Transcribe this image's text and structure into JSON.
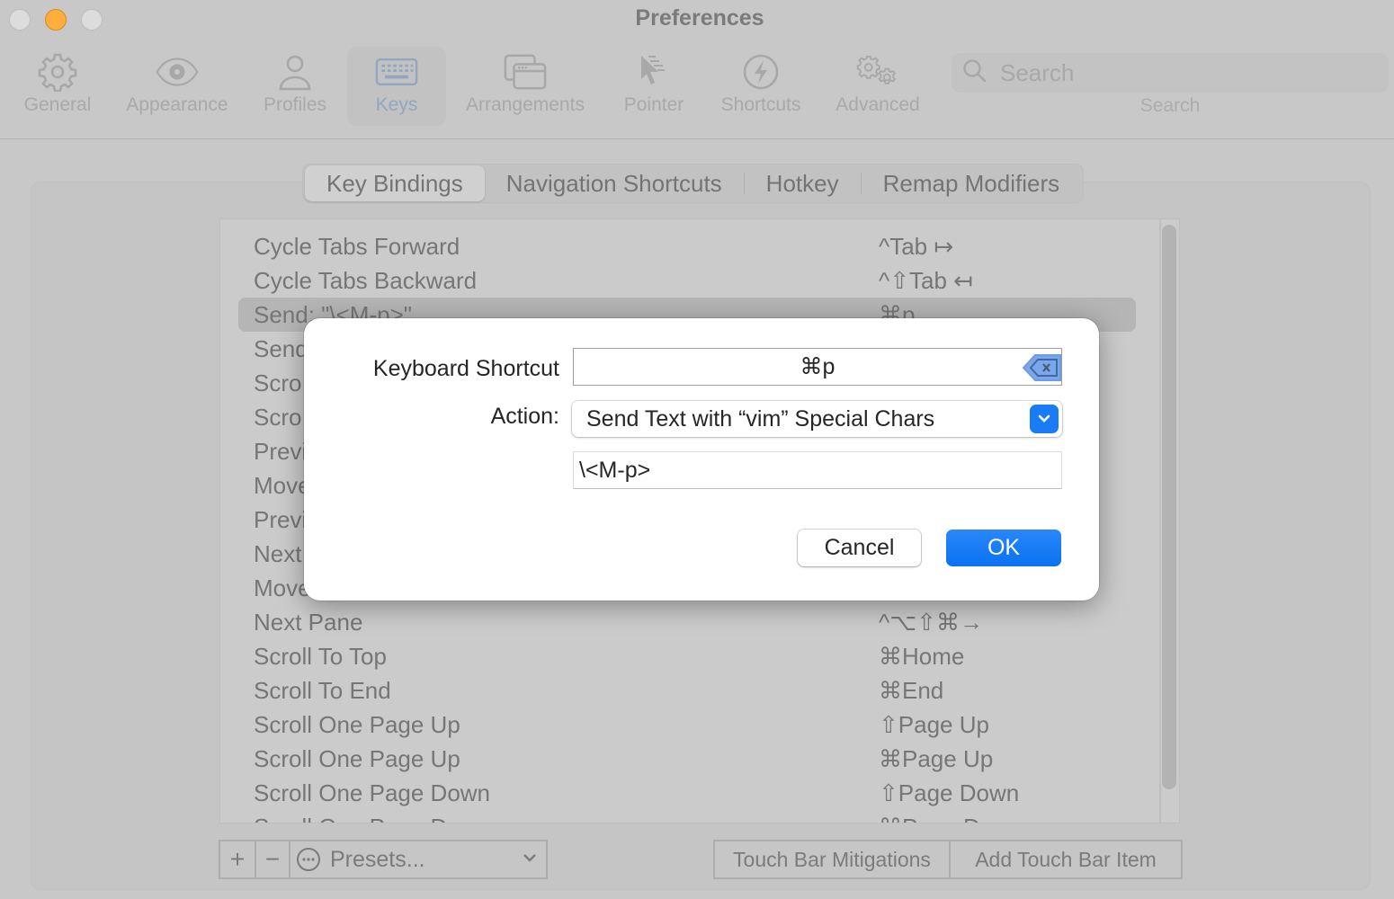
{
  "window": {
    "title": "Preferences",
    "traffic_lights": [
      "close",
      "minimize",
      "zoom"
    ]
  },
  "toolbar": {
    "items": [
      {
        "label": "General",
        "icon": "gear-icon"
      },
      {
        "label": "Appearance",
        "icon": "eye-icon"
      },
      {
        "label": "Profiles",
        "icon": "person-icon"
      },
      {
        "label": "Keys",
        "icon": "keyboard-icon",
        "active": true
      },
      {
        "label": "Arrangements",
        "icon": "windows-icon"
      },
      {
        "label": "Pointer",
        "icon": "pointer-icon"
      },
      {
        "label": "Shortcuts",
        "icon": "bolt-icon"
      },
      {
        "label": "Advanced",
        "icon": "gears-icon"
      }
    ],
    "search": {
      "placeholder": "Search",
      "value": "",
      "label": "Search"
    }
  },
  "tabs": {
    "items": [
      "Key Bindings",
      "Navigation Shortcuts",
      "Hotkey",
      "Remap Modifiers"
    ],
    "selected": "Key Bindings"
  },
  "bindings": {
    "rows": [
      {
        "action": "Cycle Tabs Forward",
        "shortcut": "^Tab ↦"
      },
      {
        "action": "Cycle Tabs Backward",
        "shortcut": "^⇧Tab ↤"
      },
      {
        "action": "Send: \"\\<M-p>\"",
        "shortcut": "⌘p",
        "selected": true
      },
      {
        "action": "Send",
        "shortcut": ""
      },
      {
        "action": "Scro",
        "shortcut": ""
      },
      {
        "action": "Scro",
        "shortcut": ""
      },
      {
        "action": "Previ",
        "shortcut": ""
      },
      {
        "action": "Move",
        "shortcut": ""
      },
      {
        "action": "Previ",
        "shortcut": ""
      },
      {
        "action": "Next",
        "shortcut": ""
      },
      {
        "action": "Move",
        "shortcut": ""
      },
      {
        "action": "Next Pane",
        "shortcut": "^⌥⇧⌘→"
      },
      {
        "action": "Scroll To Top",
        "shortcut": "⌘Home"
      },
      {
        "action": "Scroll To End",
        "shortcut": "⌘End"
      },
      {
        "action": "Scroll One Page Up",
        "shortcut": "⇧Page Up"
      },
      {
        "action": "Scroll One Page Up",
        "shortcut": "⌘Page Up"
      },
      {
        "action": "Scroll One Page Down",
        "shortcut": "⇧Page Down"
      },
      {
        "action": "Scroll One Page Down",
        "shortcut": "⌘Page Down"
      }
    ]
  },
  "bottom": {
    "add_label": "+",
    "remove_label": "−",
    "presets_label": "Presets...",
    "touch_bar_mitigations": "Touch Bar Mitigations",
    "add_touch_bar_item": "Add Touch Bar Item"
  },
  "dialog": {
    "shortcut_label": "Keyboard Shortcut",
    "shortcut_value": "⌘p",
    "action_label": "Action:",
    "action_value": "Send Text with “vim” Special Chars",
    "text_value": "\\<M-p>",
    "cancel_label": "Cancel",
    "ok_label": "OK"
  },
  "colors": {
    "accent": "#1a7cf5",
    "background": "#c8c8c8",
    "dialog_bg": "#ffffff"
  }
}
